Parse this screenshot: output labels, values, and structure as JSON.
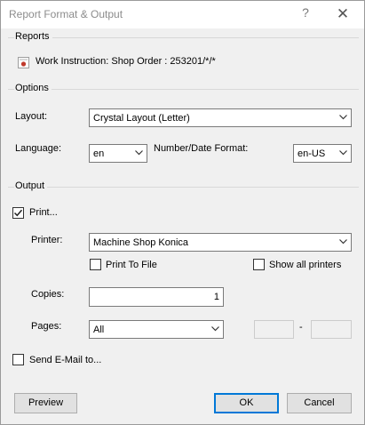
{
  "window": {
    "title": "Report Format & Output",
    "help_glyph": "?",
    "close_glyph": "✕"
  },
  "reports": {
    "group_label": "Reports",
    "items": [
      {
        "label": "Work Instruction: Shop Order : 253201/*/*",
        "icon": "report-icon"
      }
    ]
  },
  "options": {
    "group_label": "Options",
    "layout_label": "Layout:",
    "layout_value": "Crystal Layout (Letter)",
    "language_label": "Language:",
    "language_value": "en",
    "number_date_format_label": "Number/Date Format:",
    "number_date_format_value": "en-US"
  },
  "output": {
    "group_label": "Output",
    "print_label": "Print...",
    "print_checked": true,
    "printer_label": "Printer:",
    "printer_value": "Machine Shop Konica",
    "print_to_file_label": "Print To File",
    "print_to_file_checked": false,
    "show_all_printers_label": "Show all printers",
    "show_all_printers_checked": false,
    "copies_label": "Copies:",
    "copies_value": "1",
    "pages_label": "Pages:",
    "pages_value": "All",
    "page_from": "",
    "page_range_separator": "-",
    "page_to": "",
    "send_email_label": "Send E-Mail to...",
    "send_email_checked": false
  },
  "footer": {
    "preview_label": "Preview",
    "ok_label": "OK",
    "cancel_label": "Cancel"
  },
  "colors": {
    "dialog_background": "#f0f0f0",
    "title_bar": "#ffffff",
    "default_button_border": "#0078d7",
    "report_icon_red": "#c0392b"
  }
}
